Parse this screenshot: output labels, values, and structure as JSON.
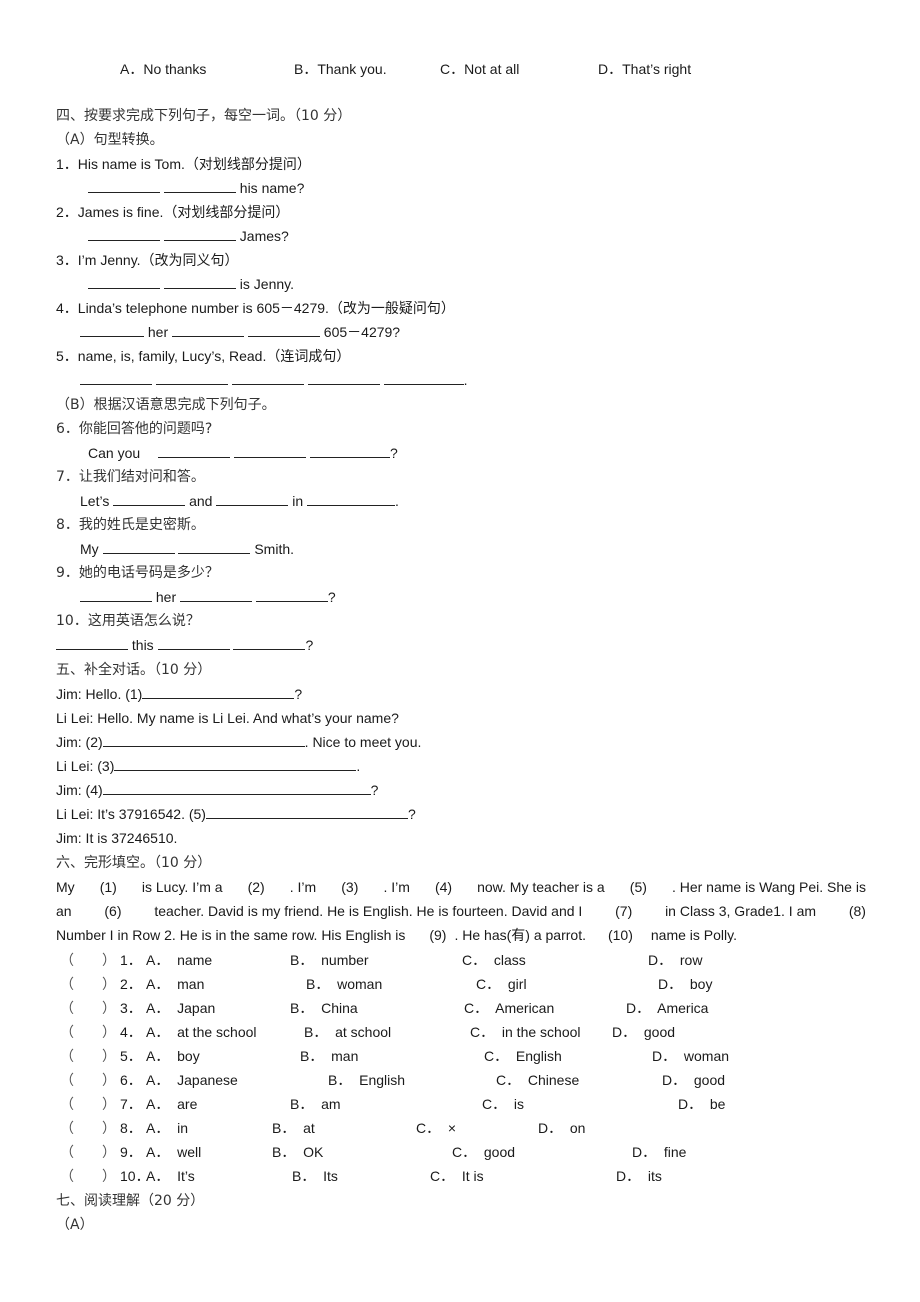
{
  "prev_options": [
    "A．No thanks",
    "B．Thank you.",
    "C．Not at all",
    "D．That’s right"
  ],
  "section4": {
    "title": "四、按要求完成下列句子，每空一词。（10 分）",
    "partA_title": "（A）句型转换。",
    "items": [
      {
        "q": "1．His name is Tom.（对划线部分提问）",
        "tail": "his name?"
      },
      {
        "q": "2．James is fine.（对划线部分提问）",
        "tail": "James?"
      },
      {
        "q": "3．I’m Jenny.（改为同义句）",
        "tail": "is Jenny."
      },
      {
        "q": "4．Linda’s telephone number is 605－4279.（改为一般疑问句）",
        "mid1": "her",
        "tail": "605－4279?"
      },
      {
        "q": "5．name, is, family, Lucy’s, Read.（连词成句）",
        "tail": "."
      }
    ],
    "partB_title": "（B）根据汉语意思完成下列句子。",
    "itemsB": [
      {
        "q": "6．你能回答他的问题吗?",
        "a_prefix": "Can you",
        "a_tail": "?"
      },
      {
        "q": "7．让我们结对问和答。",
        "a_prefix": "Let’s",
        "a_mid1": "and",
        "a_mid2": "in",
        "a_tail": "."
      },
      {
        "q": "8．我的姓氏是史密斯。",
        "a_prefix": "My",
        "a_tail": "Smith."
      },
      {
        "q": "9．她的电话号码是多少？",
        "a_mid1": "her",
        "a_tail": "?"
      },
      {
        "q": "10．这用英语怎么说？",
        "a_mid1": "this",
        "a_tail": "?"
      }
    ]
  },
  "section5": {
    "title": "五、补全对话。（10 分）",
    "lines": [
      {
        "pre": "Jim: Hello. (1)",
        "post": "?"
      },
      {
        "pre": "Li Lei: Hello. My name is Li Lei. And what’s your name?",
        "post": ""
      },
      {
        "pre": "Jim: (2)",
        "post": ". Nice to meet you."
      },
      {
        "pre": "Li Lei: (3)",
        "post": "."
      },
      {
        "pre": "Jim: (4)",
        "post": "?"
      },
      {
        "pre": "Li Lei: It’s 37916542. (5)",
        "post": "?"
      },
      {
        "pre": "Jim: It is 37246510.",
        "post": ""
      }
    ]
  },
  "section6": {
    "title": "六、完形填空。（10 分）",
    "passage": {
      "l1": [
        "My",
        "(1)",
        "is Lucy. I’m a",
        "(2)",
        ". I’m",
        "(3)",
        ". I’m",
        "(4)",
        "now. My teacher is a",
        "(5)",
        ". Her name is Wang Pei. She is"
      ],
      "l2": [
        "an",
        "(6)",
        "teacher. David is my friend. He is English. He is fourteen. David and I",
        "(7)",
        "in Class 3, Grade1. I am",
        "(8)"
      ],
      "l3": [
        "Number I in Row 2. He is in the same row. His English is",
        "(9)",
        ". He has(有) a parrot.",
        "(10)",
        "name is Polly."
      ]
    },
    "bracket_open": "（",
    "bracket_close": "）",
    "questions": [
      {
        "num": "1．",
        "A": "A．  name",
        "B": "B．  number",
        "C": "C．  class",
        "D": "D．  row"
      },
      {
        "num": "2．",
        "A": "A．  man",
        "B": "B．  woman",
        "C": "C．  girl",
        "D": "D．  boy"
      },
      {
        "num": "3．",
        "A": "A．  Japan",
        "B": "B．  China",
        "C": "C．  American",
        "D": "D．  America"
      },
      {
        "num": "4．",
        "A": "A．  at the school",
        "B": "B．  at school",
        "C": "C．  in the school",
        "D": "D．  good"
      },
      {
        "num": "5．",
        "A": "A．  boy",
        "B": "B．  man",
        "C": "C．  English",
        "D": "D．  woman"
      },
      {
        "num": "6．",
        "A": "A．  Japanese",
        "B": "B．  English",
        "C": "C．  Chinese",
        "D": "D．  good"
      },
      {
        "num": "7．",
        "A": "A．  are",
        "B": "B．  am",
        "C": "C．  is",
        "D": "D．  be"
      },
      {
        "num": "8．",
        "A": "A．  in",
        "B": "B．  at",
        "C": "C．  ×",
        "D": "D．  on"
      },
      {
        "num": "9．",
        "A": "A．  well",
        "B": "B．  OK",
        "C": "C．  good",
        "D": "D．  fine"
      },
      {
        "num": "10．",
        "A": "A．  It’s",
        "B": "B．  Its",
        "C": "C．  It is",
        "D": "D．  its"
      }
    ]
  },
  "section7": {
    "title": "七、阅读理解（20 分）",
    "partA_title": "（A）"
  }
}
